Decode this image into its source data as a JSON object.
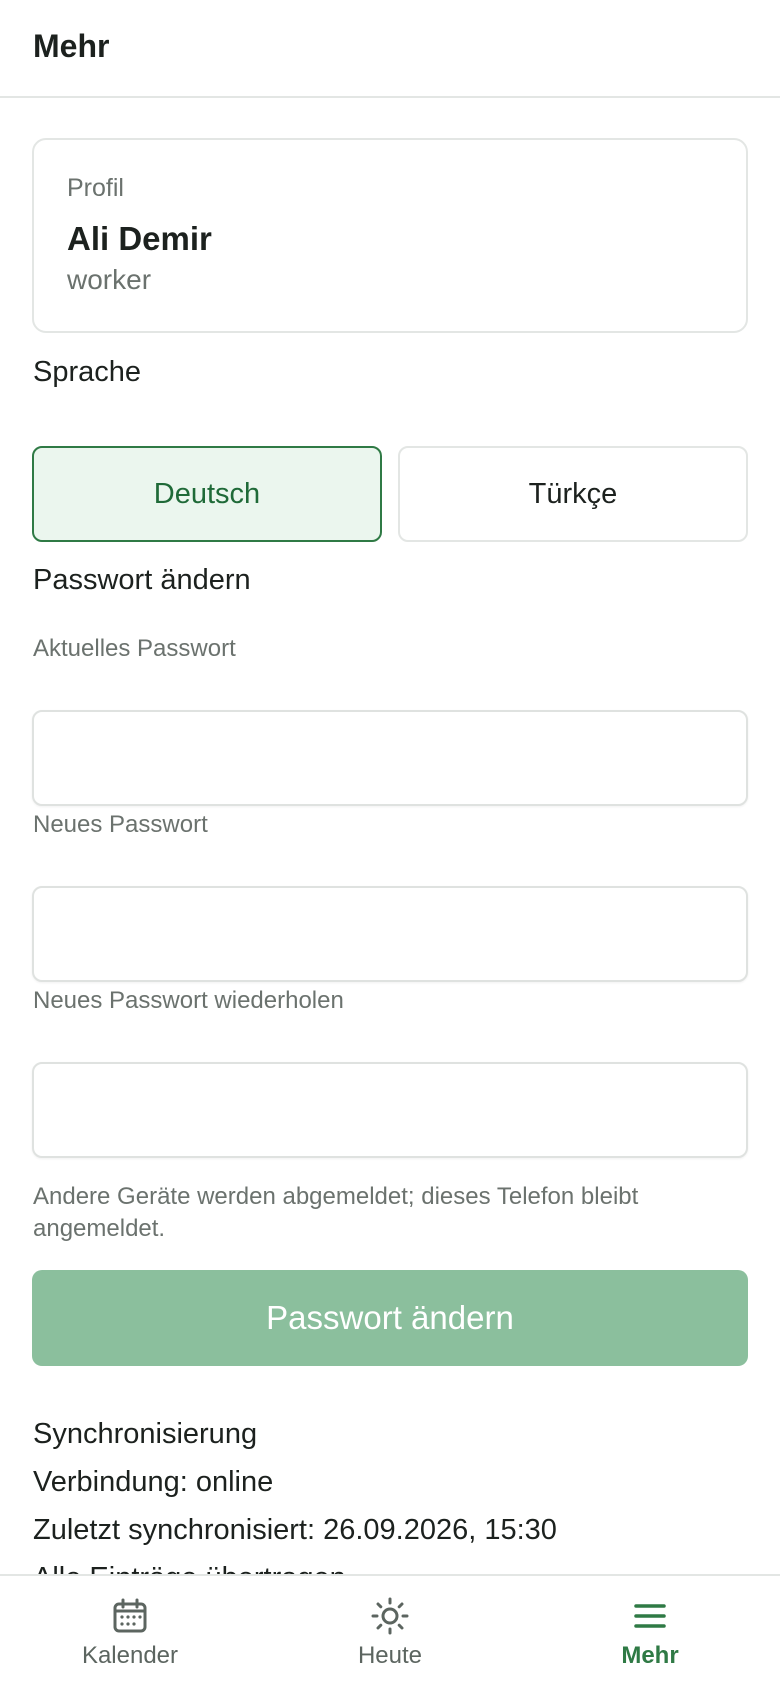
{
  "header": {
    "title": "Mehr"
  },
  "profile": {
    "label": "Profil",
    "name": "Ali Demir",
    "role": "worker"
  },
  "language": {
    "title": "Sprache",
    "options": [
      {
        "label": "Deutsch",
        "selected": true
      },
      {
        "label": "Türkçe",
        "selected": false
      }
    ]
  },
  "password": {
    "title": "Passwort ändern",
    "current_label": "Aktuelles Passwort",
    "new_label": "Neues Passwort",
    "repeat_label": "Neues Passwort wiederholen",
    "hint": "Andere Geräte werden abgemeldet; dieses Telefon bleibt angemeldet.",
    "submit_label": "Passwort ändern"
  },
  "sync": {
    "title": "Synchronisierung",
    "connection": "Verbindung: online",
    "last_synced": "Zuletzt synchronisiert: 26.09.2026, 15:30",
    "status": "Alle Einträge übertragen"
  },
  "tabs": [
    {
      "label": "Kalender",
      "icon": "calendar-icon",
      "active": false
    },
    {
      "label": "Heute",
      "icon": "sun-icon",
      "active": false
    },
    {
      "label": "Mehr",
      "icon": "menu-icon",
      "active": true
    }
  ],
  "colors": {
    "accent": "#2f7a45",
    "accent_bg": "#ebf6ee",
    "button_disabled": "#8bbf9d",
    "muted_text": "#6b726e",
    "border": "#e3e6e4"
  }
}
